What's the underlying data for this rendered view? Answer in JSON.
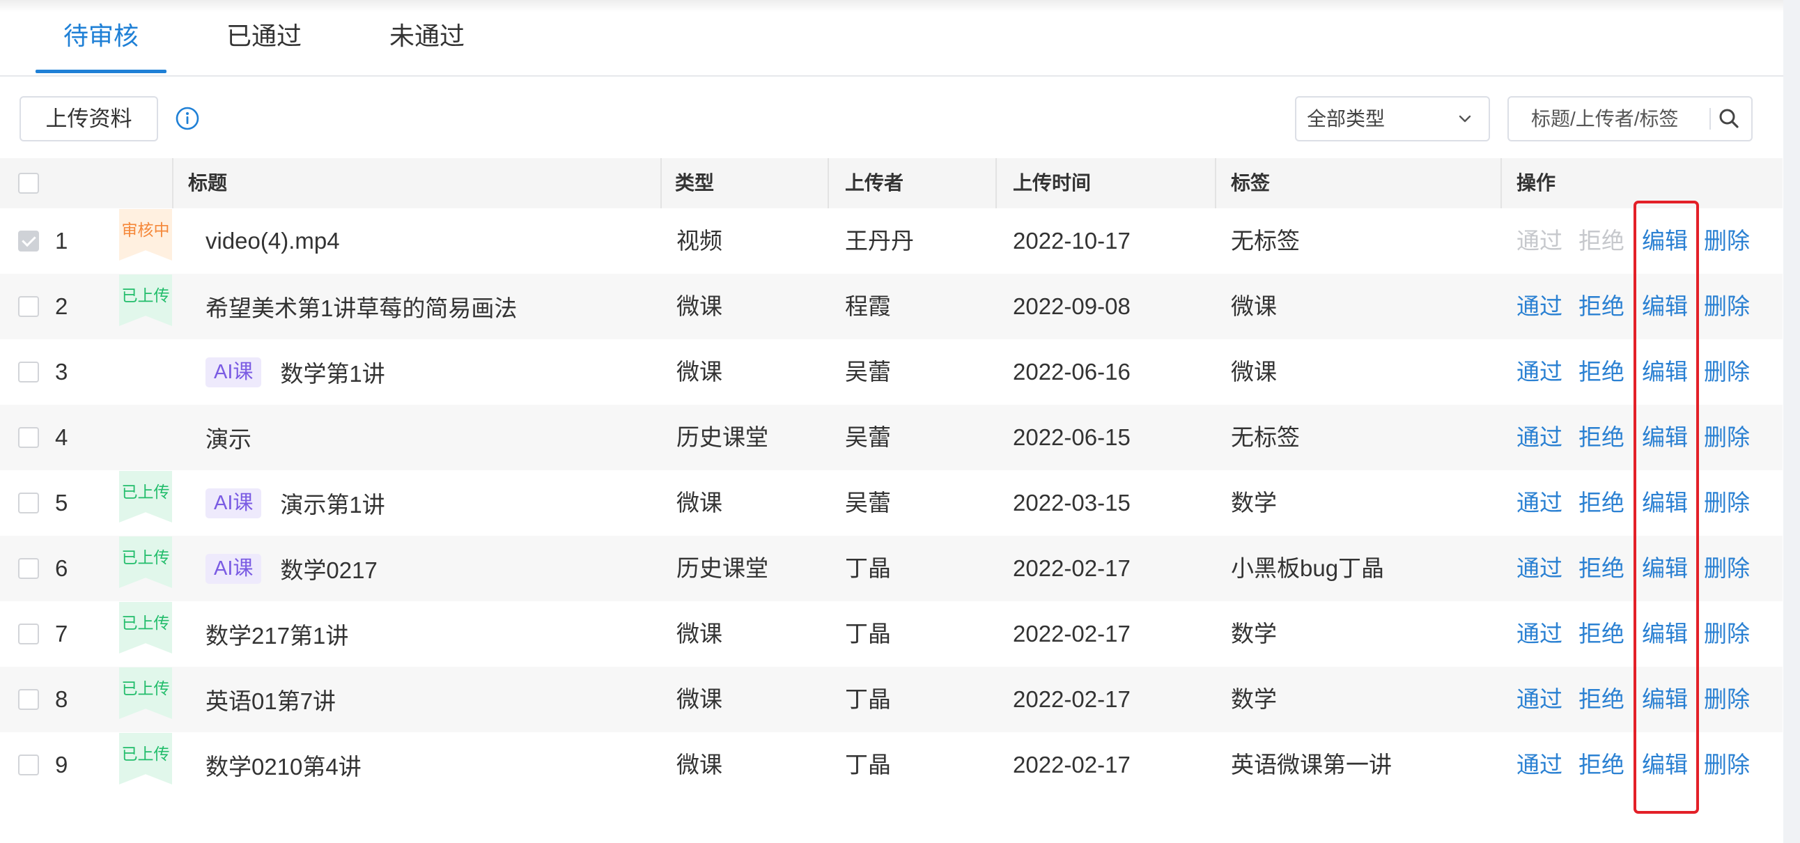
{
  "colors": {
    "accent": "#1f80d6",
    "link": "#2a80d2",
    "disabled": "#c6c8cc",
    "highlight": "#e32028",
    "info": "#1f80d6",
    "ai_text": "#7a5be3",
    "ai_bg": "#eeeafc"
  },
  "tabs": [
    {
      "label": "待审核",
      "active": true
    },
    {
      "label": "已通过",
      "active": false
    },
    {
      "label": "未通过",
      "active": false
    }
  ],
  "toolbar": {
    "upload_label": "上传资料",
    "info_icon": "info-icon",
    "type_filter": {
      "selected": "全部类型",
      "icon": "chevron-down-icon"
    },
    "search": {
      "placeholder": "标题/上传者/标签",
      "icon": "search-icon"
    }
  },
  "table": {
    "headers": {
      "title": "标题",
      "type": "类型",
      "uploader": "上传者",
      "upload_time": "上传时间",
      "tag": "标签",
      "actions": "操作"
    },
    "action_labels": {
      "approve": "通过",
      "reject": "拒绝",
      "edit": "编辑",
      "delete": "删除"
    },
    "rows": [
      {
        "index": "1",
        "checked": true,
        "checkbox_disabled": true,
        "badge": "审核中",
        "badge_color": "#f5883a",
        "badge_bg": "#fff0e0",
        "title": "video(4).mp4",
        "type": "视频",
        "uploader": "王丹丹",
        "upload_time": "2022-10-17",
        "tag": "无标签",
        "review_disabled": true
      },
      {
        "index": "2",
        "checked": false,
        "badge": "已上传",
        "badge_color": "#22bd6b",
        "badge_bg": "#e1f7eb",
        "title": "希望美术第1讲草莓的简易画法",
        "type": "微课",
        "uploader": "程霞",
        "upload_time": "2022-09-08",
        "tag": "微课",
        "review_disabled": false
      },
      {
        "index": "3",
        "checked": false,
        "ai_tag": "AI课",
        "title": "数学第1讲",
        "type": "微课",
        "uploader": "吴蕾",
        "upload_time": "2022-06-16",
        "tag": "微课",
        "review_disabled": false
      },
      {
        "index": "4",
        "checked": false,
        "title": "演示",
        "type": "历史课堂",
        "uploader": "吴蕾",
        "upload_time": "2022-06-15",
        "tag": "无标签",
        "review_disabled": false
      },
      {
        "index": "5",
        "checked": false,
        "badge": "已上传",
        "badge_color": "#22bd6b",
        "badge_bg": "#e1f7eb",
        "ai_tag": "AI课",
        "title": "演示第1讲",
        "type": "微课",
        "uploader": "吴蕾",
        "upload_time": "2022-03-15",
        "tag": "数学",
        "review_disabled": false
      },
      {
        "index": "6",
        "checked": false,
        "badge": "已上传",
        "badge_color": "#22bd6b",
        "badge_bg": "#e1f7eb",
        "ai_tag": "AI课",
        "title": "数学0217",
        "type": "历史课堂",
        "uploader": "丁晶",
        "upload_time": "2022-02-17",
        "tag": "小黑板bug丁晶",
        "review_disabled": false
      },
      {
        "index": "7",
        "checked": false,
        "badge": "已上传",
        "badge_color": "#22bd6b",
        "badge_bg": "#e1f7eb",
        "title": "数学217第1讲",
        "type": "微课",
        "uploader": "丁晶",
        "upload_time": "2022-02-17",
        "tag": "数学",
        "review_disabled": false
      },
      {
        "index": "8",
        "checked": false,
        "badge": "已上传",
        "badge_color": "#22bd6b",
        "badge_bg": "#e1f7eb",
        "title": "英语01第7讲",
        "type": "微课",
        "uploader": "丁晶",
        "upload_time": "2022-02-17",
        "tag": "数学",
        "review_disabled": false
      },
      {
        "index": "9",
        "checked": false,
        "badge": "已上传",
        "badge_color": "#22bd6b",
        "badge_bg": "#e1f7eb",
        "title": "数学0210第4讲",
        "type": "微课",
        "uploader": "丁晶",
        "upload_time": "2022-02-17",
        "tag": "英语微课第一讲",
        "review_disabled": false
      }
    ]
  }
}
